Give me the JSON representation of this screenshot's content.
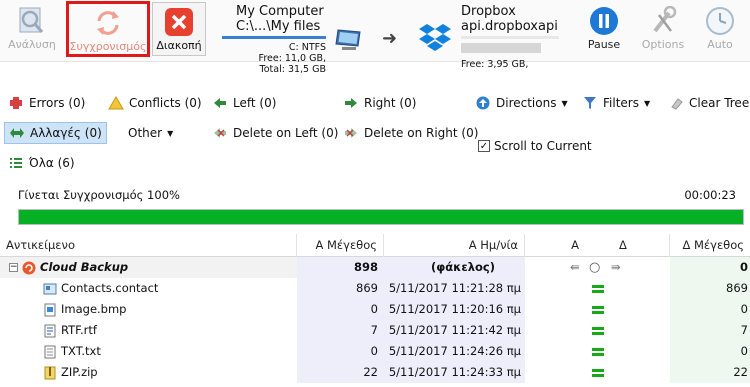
{
  "toolbar": {
    "analyze_label": "Ανάλυση",
    "sync_label": "Συγχρονισμός",
    "abort_label": "Διακοπή",
    "pause_label": "Pause",
    "options_label": "Options",
    "auto_label": "Auto"
  },
  "left_location": {
    "title": "My Computer",
    "path": "C:\\...\\My files",
    "fs": "C: NTFS",
    "free": "Free: 11,0 GB,",
    "total": "Total: 31,5 GB"
  },
  "right_location": {
    "title": "Dropbox",
    "path": "api.dropboxapi.c",
    "free": "Free: 3,95 GB,"
  },
  "filters": {
    "errors": "Errors (0)",
    "conflicts": "Conflicts (0)",
    "left": "Left (0)",
    "right": "Right (0)",
    "directions": "Directions",
    "filters": "Filters",
    "clear_tree": "Clear Tree",
    "changes": "Αλλαγές (0)",
    "other": "Other",
    "delete_left": "Delete on Left (0)",
    "delete_right": "Delete on Right (0)",
    "scroll_to_current": "Scroll to Current",
    "all": "Όλα (6)"
  },
  "status": {
    "label": "Γίνεται Συγχρονισμός 100%",
    "time": "00:00:23",
    "progress": 1.0
  },
  "table": {
    "headers": {
      "name": "Αντικείμενο",
      "size": "Α Μέγεθος",
      "date": "Α Ημ/νία",
      "a": "Α",
      "d": "Δ",
      "rsize": "Δ Μέγεθος"
    },
    "folder": {
      "name": "Cloud Backup",
      "size": "898",
      "date": "(φάκελος)",
      "rsize": "0"
    },
    "rows": [
      {
        "name": "Contacts.contact",
        "size": "869",
        "date": "5/11/2017 11:21:28 πμ",
        "rsize": "869",
        "icon": "contact-file-icon"
      },
      {
        "name": "Image.bmp",
        "size": "0",
        "date": "5/11/2017 11:20:16 πμ",
        "rsize": "0",
        "icon": "image-file-icon"
      },
      {
        "name": "RTF.rtf",
        "size": "7",
        "date": "5/11/2017 11:21:42 πμ",
        "rsize": "7",
        "icon": "rtf-file-icon"
      },
      {
        "name": "TXT.txt",
        "size": "0",
        "date": "5/11/2017 11:24:26 πμ",
        "rsize": "0",
        "icon": "text-file-icon"
      },
      {
        "name": "ZIP.zip",
        "size": "22",
        "date": "5/11/2017 11:24:33 πμ",
        "rsize": "22",
        "icon": "zip-file-icon"
      }
    ]
  }
}
